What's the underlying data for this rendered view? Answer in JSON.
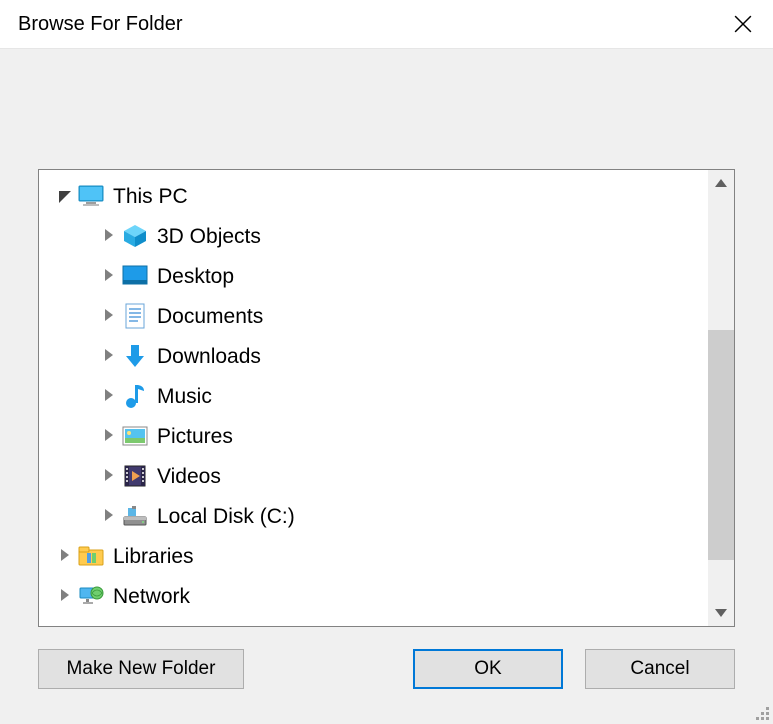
{
  "title": "Browse For Folder",
  "tree": {
    "root": {
      "label": "This PC",
      "icon": "monitor"
    },
    "children": [
      {
        "label": "3D Objects",
        "icon": "cube"
      },
      {
        "label": "Desktop",
        "icon": "desktop"
      },
      {
        "label": "Documents",
        "icon": "documents"
      },
      {
        "label": "Downloads",
        "icon": "download"
      },
      {
        "label": "Music",
        "icon": "music"
      },
      {
        "label": "Pictures",
        "icon": "pictures"
      },
      {
        "label": "Videos",
        "icon": "videos"
      },
      {
        "label": "Local Disk (C:)",
        "icon": "drive"
      }
    ],
    "siblings": [
      {
        "label": "Libraries",
        "icon": "libraries"
      },
      {
        "label": "Network",
        "icon": "network"
      }
    ]
  },
  "buttons": {
    "new": "Make New Folder",
    "ok": "OK",
    "cancel": "Cancel"
  }
}
